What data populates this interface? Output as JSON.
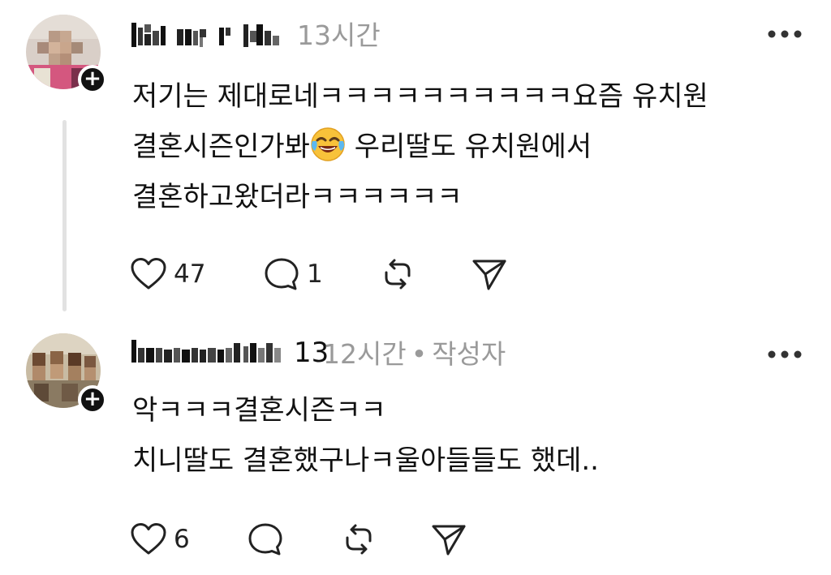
{
  "posts": [
    {
      "username_visible_suffix": "",
      "time": "13시간",
      "author_tag": "",
      "lines": [
        "저기는 제대로네ㅋㅋㅋㅋㅋㅋㅋㅋㅋㅋ요즘 유치원",
        "결혼시즌인가봐",
        "우리딸도 유치원에서",
        "결혼하고왔더라ㅋㅋㅋㅋㅋㅋ"
      ],
      "emoji": "face-with-tears-of-joy",
      "likes": "47",
      "replies": "1"
    },
    {
      "username_visible_suffix": "13",
      "time": "12시간",
      "dot": "•",
      "author_tag": "작성자",
      "lines": [
        "악ㅋㅋㅋ결혼시즌ㅋㅋ",
        "치니딸도 결혼했구나ㅋ울아들들도 했데.."
      ],
      "likes": "6",
      "replies": ""
    }
  ],
  "icons": {
    "like": "heart-icon",
    "reply": "comment-icon",
    "repost": "repost-icon",
    "share": "send-icon",
    "more": "more-icon",
    "follow": "plus-icon"
  },
  "follow_symbol": "+",
  "colors": {
    "text": "#111111",
    "meta": "#9a9a9a",
    "thread_line": "#e2e2e2",
    "badge": "#111111"
  }
}
